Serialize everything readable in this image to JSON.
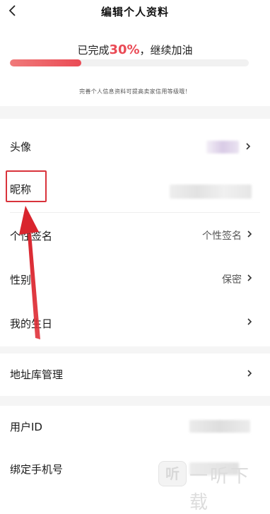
{
  "header": {
    "title": "编辑个人资料",
    "back_icon": "chevron-left-icon"
  },
  "progress": {
    "prefix": "已完成",
    "percent_text": "30%",
    "suffix": "，继续加油",
    "fraction": 0.3,
    "hint": "完善个人信息资料可提高卖家信用等级哦！",
    "accent": "#ea4a55"
  },
  "rows": [
    {
      "label": "头像",
      "value": ""
    },
    {
      "label": "昵称",
      "value": ""
    },
    {
      "label": "个性签名",
      "value": "个性签名"
    },
    {
      "label": "性别",
      "value": "保密"
    },
    {
      "label": "我的生日",
      "value": ""
    },
    {
      "label": "地址库管理",
      "value": ""
    },
    {
      "label": "用户ID",
      "value": ""
    },
    {
      "label": "绑定手机号",
      "value": ""
    }
  ],
  "annotation": {
    "highlight_color": "#d9333b"
  },
  "watermark": {
    "logo_glyph": "听",
    "text": "一听下载"
  }
}
